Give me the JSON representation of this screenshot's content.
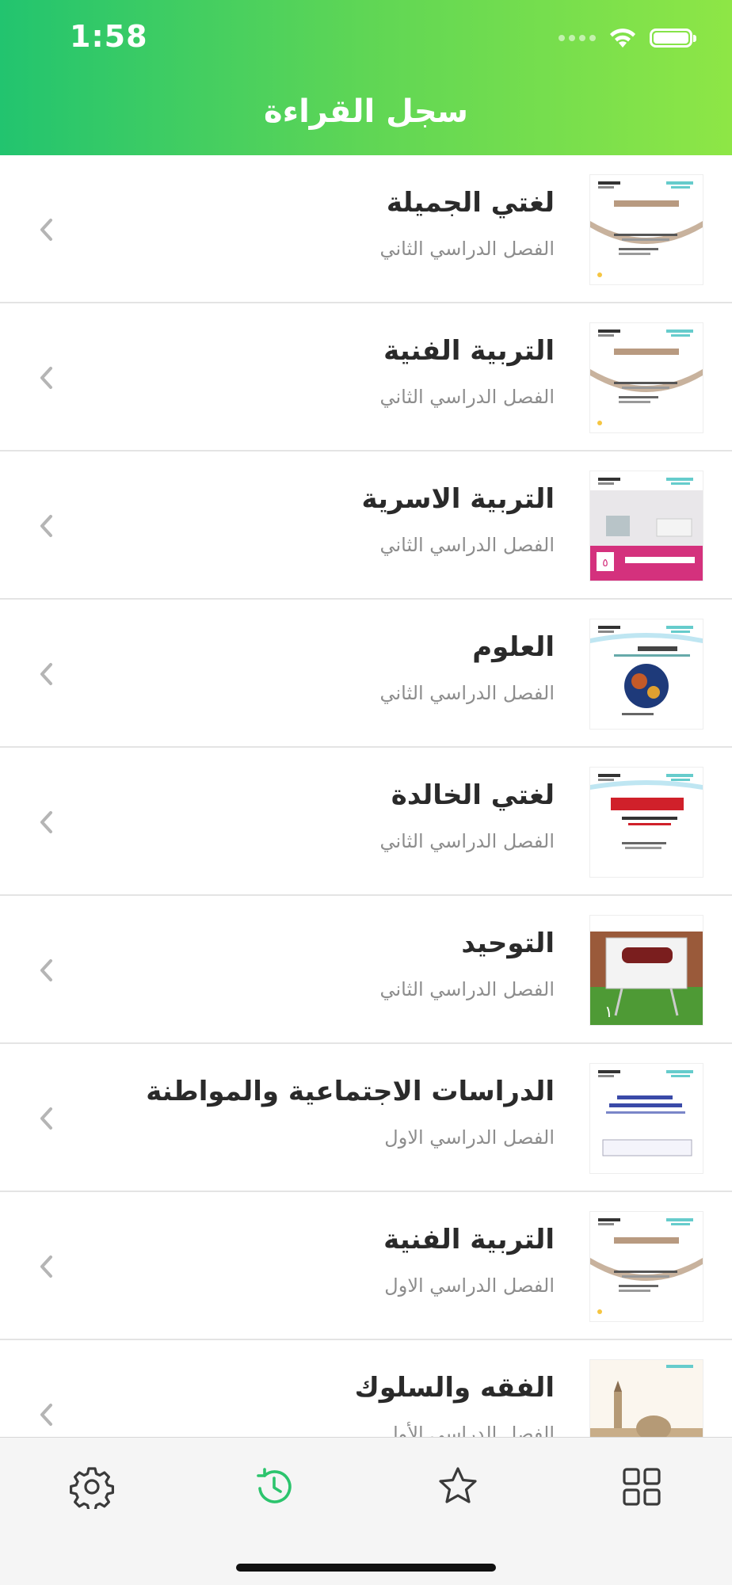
{
  "status_bar": {
    "time": "1:58",
    "wifi_icon": "wifi-icon",
    "battery_icon": "battery-icon"
  },
  "header": {
    "title": "سجل القراءة"
  },
  "books": [
    {
      "title": "لغتي الجميلة",
      "semester": "الفصل الدراسي الثاني",
      "cover_icon": "book-cover",
      "cover_style": "arc"
    },
    {
      "title": "التربية الفنية",
      "semester": "الفصل الدراسي الثاني",
      "cover_icon": "book-cover",
      "cover_style": "arc"
    },
    {
      "title": "التربية الاسرية",
      "semester": "الفصل الدراسي الثاني",
      "cover_icon": "book-cover",
      "cover_style": "room"
    },
    {
      "title": "العلوم",
      "semester": "الفصل الدراسي الثاني",
      "cover_icon": "book-cover",
      "cover_style": "globe"
    },
    {
      "title": "لغتي الخالدة",
      "semester": "الفصل الدراسي الثاني",
      "cover_icon": "book-cover",
      "cover_style": "red-title"
    },
    {
      "title": "التوحيد",
      "semester": "الفصل الدراسي الثاني",
      "cover_icon": "book-cover",
      "cover_style": "board"
    },
    {
      "title": "الدراسات الاجتماعية والمواطنة",
      "semester": "الفصل الدراسي الاول",
      "cover_icon": "book-cover",
      "cover_style": "plain"
    },
    {
      "title": "التربية الفنية",
      "semester": "الفصل الدراسي الاول",
      "cover_icon": "book-cover",
      "cover_style": "arc"
    },
    {
      "title": "الفقه والسلوك",
      "semester": "الفصل الدراسي الأول",
      "cover_icon": "book-cover",
      "cover_style": "mosque"
    }
  ],
  "tabbar": {
    "tabs": [
      {
        "icon": "gear-icon",
        "active": false
      },
      {
        "icon": "history-icon",
        "active": true
      },
      {
        "icon": "star-icon",
        "active": false
      },
      {
        "icon": "grid-icon",
        "active": false
      }
    ],
    "active_color": "#2cc46d",
    "inactive_color": "#3a3a3a"
  }
}
